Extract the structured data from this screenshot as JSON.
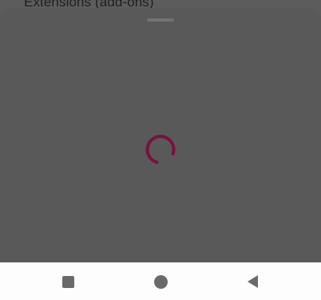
{
  "background_page": {
    "section_title": "Extensions (add-ons)"
  },
  "sheet": {
    "state": "loading",
    "spinner_color": "#7a1040"
  },
  "navbar": {
    "buttons": [
      {
        "icon": "recents-square-icon"
      },
      {
        "icon": "home-circle-icon"
      },
      {
        "icon": "back-triangle-icon"
      }
    ]
  },
  "colors": {
    "scrim": "#5c5c5c",
    "sheet": "#595959",
    "navbar": "#fdfdfd",
    "nav_icon": "#6a6a6a"
  }
}
